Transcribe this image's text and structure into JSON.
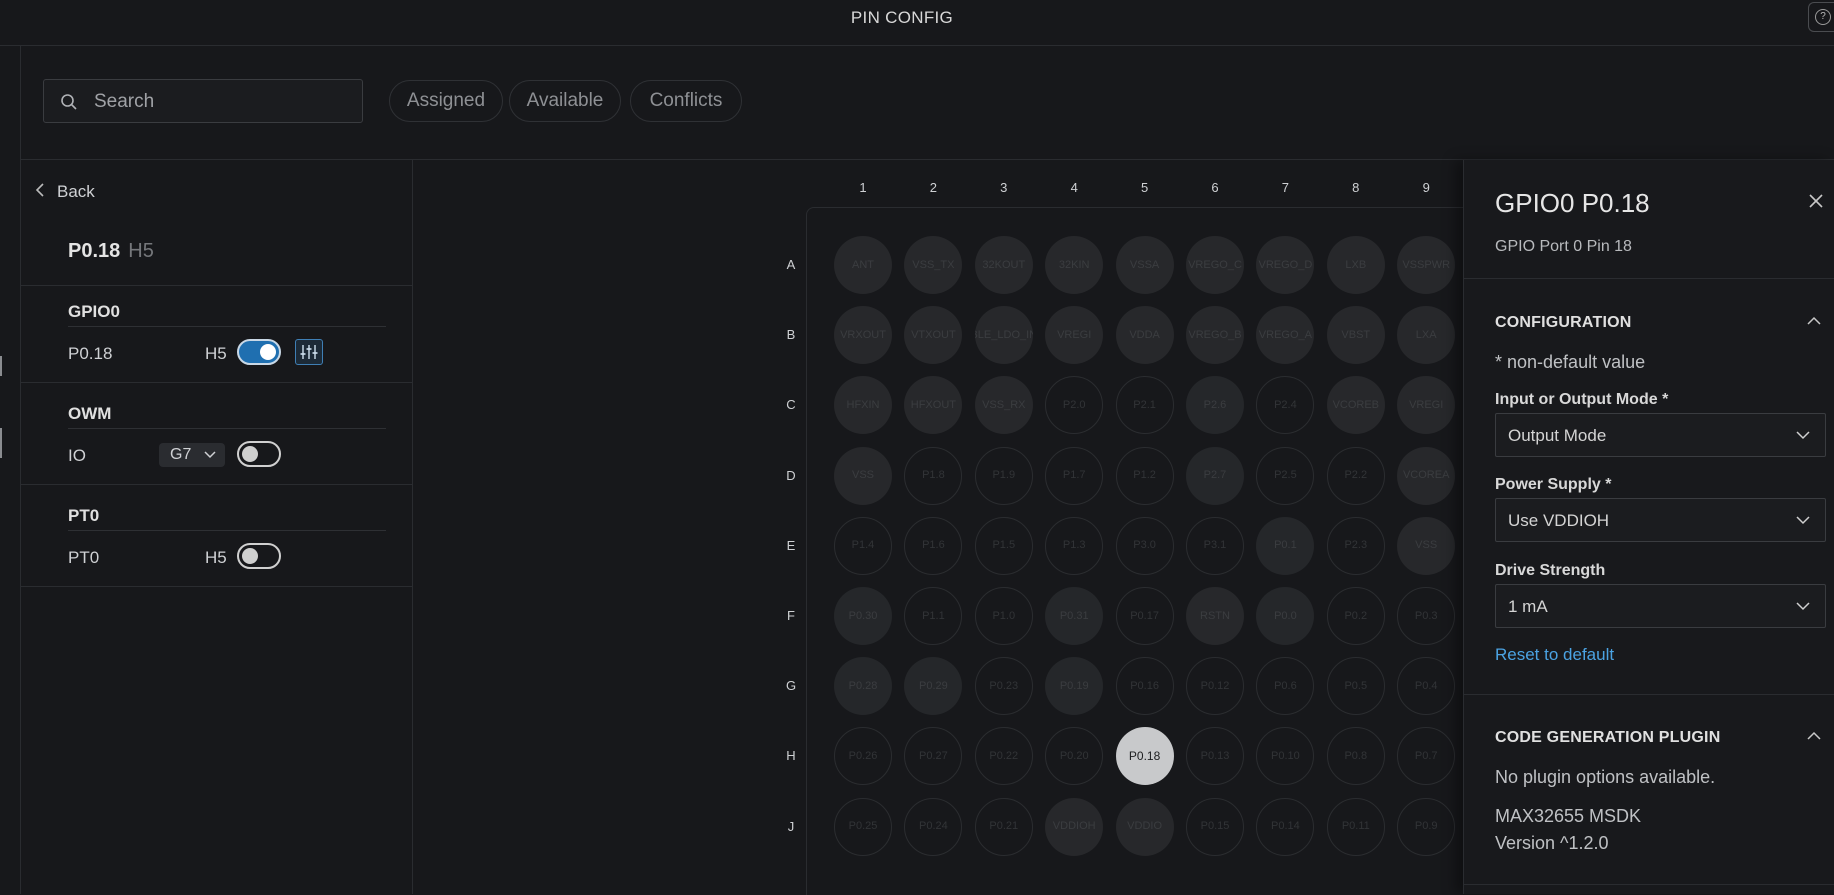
{
  "header": {
    "title": "PIN CONFIG"
  },
  "toolbar": {
    "search_placeholder": "Search",
    "filters": [
      "Assigned",
      "Available",
      "Conflicts"
    ]
  },
  "left_panel": {
    "back_label": "Back",
    "pin_name": "P0.18",
    "pin_location": "H5",
    "groups": [
      {
        "title": "GPIO0",
        "signal": "P0.18",
        "pin": "H5",
        "enabled": true
      },
      {
        "title": "OWM",
        "signal": "IO",
        "pin_select": "G7",
        "enabled": false
      },
      {
        "title": "PT0",
        "signal": "PT0",
        "pin": "H5",
        "enabled": false
      }
    ]
  },
  "grid": {
    "columns": [
      "1",
      "2",
      "3",
      "4",
      "5",
      "6",
      "7",
      "8",
      "9"
    ],
    "rows": [
      "A",
      "B",
      "C",
      "D",
      "E",
      "F",
      "G",
      "H",
      "J"
    ],
    "pins": [
      [
        "ANT",
        "VSS_TX",
        "32KOUT",
        "32KIN",
        "VSSA",
        "VREGO_C",
        "VREGO_D",
        "LXB",
        "VSSPWR"
      ],
      [
        "VRXOUT",
        "VTXOUT",
        "BLE_LDO_IN",
        "VREGI",
        "VDDA",
        "VREGO_B",
        "VREGO_A",
        "VBST",
        "LXA"
      ],
      [
        "HFXIN",
        "HFXOUT",
        "VSS_RX",
        "P2.0",
        "P2.1",
        "P2.6",
        "P2.4",
        "VCOREB",
        "VREGI"
      ],
      [
        "VSS",
        "P1.8",
        "P1.9",
        "P1.7",
        "P1.2",
        "P2.7",
        "P2.5",
        "P2.2",
        "VCOREA"
      ],
      [
        "P1.4",
        "P1.6",
        "P1.5",
        "P1.3",
        "P3.0",
        "P3.1",
        "P0.1",
        "P2.3",
        "VSS"
      ],
      [
        "P0.30",
        "P1.1",
        "P1.0",
        "P0.31",
        "P0.17",
        "RSTN",
        "P0.0",
        "P0.2",
        "P0.3"
      ],
      [
        "P0.28",
        "P0.29",
        "P0.23",
        "P0.19",
        "P0.16",
        "P0.12",
        "P0.6",
        "P0.5",
        "P0.4"
      ],
      [
        "P0.26",
        "P0.27",
        "P0.22",
        "P0.20",
        "P0.18",
        "P0.13",
        "P0.10",
        "P0.8",
        "P0.7"
      ],
      [
        "P0.25",
        "P0.24",
        "P0.21",
        "VDDIOH",
        "VDDIO",
        "P0.15",
        "P0.14",
        "P0.11",
        "P0.9"
      ]
    ],
    "pin_state": [
      [
        "f",
        "f",
        "f",
        "f",
        "f",
        "f",
        "f",
        "f",
        "f"
      ],
      [
        "f",
        "f",
        "f",
        "f",
        "f",
        "f",
        "f",
        "f",
        "f"
      ],
      [
        "f",
        "f",
        "f",
        "g",
        "g",
        "a",
        "g",
        "f",
        "f"
      ],
      [
        "f",
        "g",
        "g",
        "g",
        "g",
        "a",
        "g",
        "g",
        "f"
      ],
      [
        "g",
        "g",
        "g",
        "g",
        "g",
        "g",
        "a",
        "g",
        "f"
      ],
      [
        "a",
        "g",
        "g",
        "a",
        "g",
        "f",
        "a",
        "g",
        "g"
      ],
      [
        "a",
        "a",
        "g",
        "a",
        "g",
        "g",
        "g",
        "g",
        "g"
      ],
      [
        "g",
        "g",
        "g",
        "g",
        "s",
        "g",
        "g",
        "g",
        "g"
      ],
      [
        "g",
        "g",
        "g",
        "f",
        "f",
        "g",
        "g",
        "g",
        "g"
      ]
    ]
  },
  "right_panel": {
    "title": "GPIO0 P0.18",
    "subtitle": "GPIO Port 0 Pin 18",
    "configuration": {
      "section_title": "CONFIGURATION",
      "note": "* non-default value",
      "fields": [
        {
          "label": "Input or Output Mode *",
          "value": "Output Mode"
        },
        {
          "label": "Power Supply *",
          "value": "Use VDDIOH"
        },
        {
          "label": "Drive Strength",
          "value": "1 mA"
        }
      ],
      "reset_label": "Reset to default"
    },
    "code_gen": {
      "section_title": "CODE GENERATION PLUGIN",
      "message": "No plugin options available.",
      "sdk_name": "MAX32655 MSDK",
      "sdk_version": "Version ^1.2.0"
    }
  },
  "colors": {
    "accent": "#1f6fb0",
    "link": "#4ba3e3",
    "selected_pin": "#c8c9cb"
  }
}
